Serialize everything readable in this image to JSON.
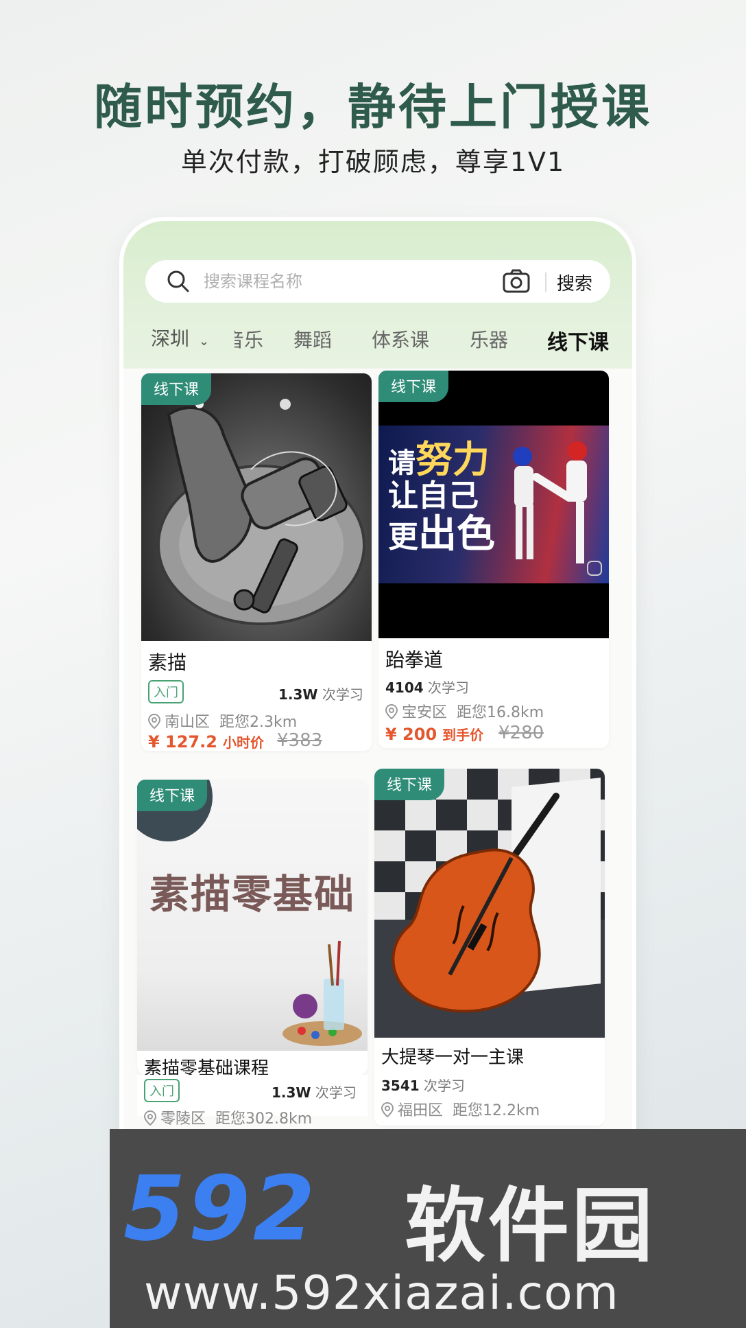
{
  "header": {
    "headline": "随时预约，静待上门授课",
    "subline": "单次付款，打破顾虑，尊享1V1"
  },
  "search": {
    "placeholder": "搜索课程名称",
    "button_label": "搜索",
    "camera_icon": "camera-icon",
    "search_icon": "search-icon"
  },
  "nav": {
    "city": "深圳",
    "partial_tab": "音乐",
    "tabs": [
      "舞蹈",
      "体系课",
      "乐器",
      "线下课"
    ],
    "active_tab": "线下课"
  },
  "courses": [
    {
      "badge": "线下课",
      "title": "素描",
      "level": "入门",
      "learners_count": "1.3W",
      "learners_label": "次学习",
      "district": "南山区",
      "distance": "距您2.3km",
      "price": "¥ 127.2",
      "price_unit": "小时价",
      "original_price": "¥383",
      "image_desc": "pencil sketch of faucet"
    },
    {
      "badge": "线下课",
      "title": "跆拳道",
      "learners_count": "4104",
      "learners_label": "次学习",
      "district": "宝安区",
      "distance": "距您16.8km",
      "price": "¥ 200",
      "price_unit": "到手价",
      "original_price": "¥280",
      "poster_line1_a": "请",
      "poster_line1_b": "努力",
      "poster_line2": "让自己",
      "poster_line3_a": "更",
      "poster_line3_b": "出色"
    },
    {
      "badge": "线下课",
      "title": "素描零基础课程",
      "level": "入门",
      "learners_count": "1.3W",
      "learners_label": "次学习",
      "district": "零陵区",
      "distance": "距您302.8km",
      "poster_text": "素描零基础"
    },
    {
      "badge": "线下课",
      "title": "大提琴一对一主课",
      "learners_count": "3541",
      "learners_label": "次学习",
      "district": "福田区",
      "distance": "距您12.2km"
    }
  ],
  "watermark": {
    "number": "592",
    "name": "软件园",
    "url": "www.592xiazai.com"
  },
  "colors": {
    "headline": "#2f5b4c",
    "badge": "#2e8c77",
    "price": "#e4572e",
    "level_border": "#48a274",
    "watermark_blue": "#3b7ff1"
  }
}
